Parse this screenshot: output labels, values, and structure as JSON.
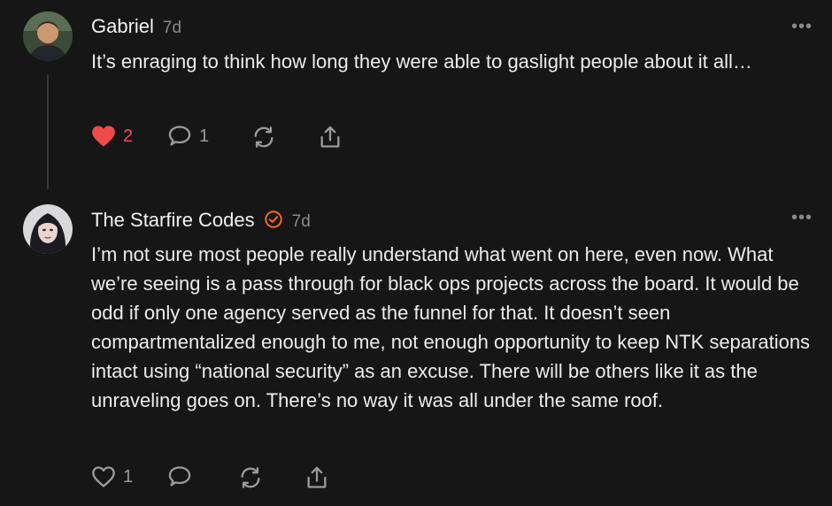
{
  "posts": [
    {
      "author": "Gabriel",
      "time": "7d",
      "text": "It’s enraging to think how long they were able to gaslight people about it all…",
      "likes": "2",
      "replies": "1",
      "liked": true
    },
    {
      "author": "The Starfire Codes",
      "verified": true,
      "time": "7d",
      "text": "I’m not sure most people really understand what went on here, even now. What we’re seeing is a pass through for black ops projects across the board. It would be odd if only one agency served as the funnel for that. It doesn’t seen compartmentalized enough to me, not enough opportunity to keep NTK separations intact using “national security” as an excuse. There will be others like it as the unraveling goes on. There’s no way it was all under the same roof.",
      "likes": "1",
      "replies": "",
      "liked": false
    }
  ],
  "icons": {
    "more": "more-icon",
    "like": "heart-icon",
    "reply": "comment-icon",
    "repost": "repost-icon",
    "share": "share-icon",
    "verified": "verified-badge-icon"
  },
  "colors": {
    "background": "#161616",
    "liked": "#ef4b4b",
    "verified": "#f26a21"
  },
  "ui": {
    "more_label": "•••"
  }
}
